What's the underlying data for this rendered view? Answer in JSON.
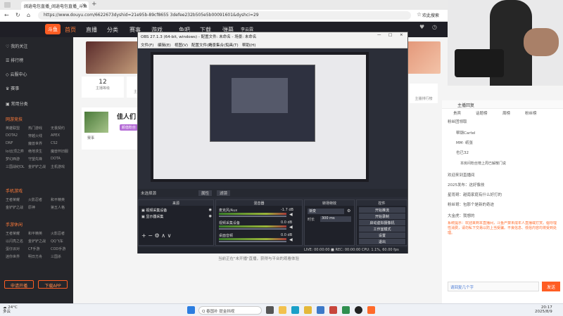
{
  "browser": {
    "tab_title": "阔逍电包直播_阔逍电包直播_斗鱼",
    "url": "https://www.douyu.com/6622673dyshid=21e95b-89cf8655 3defee232b505e5b00091601&dyshci=29",
    "profile_label": "欢此搜索"
  },
  "site": {
    "logo": "斗鱼",
    "nav": [
      "首页",
      "直播",
      "分类",
      "赛事",
      "游戏",
      "鱼吧",
      "下载",
      "弹幕",
      "李云霖"
    ],
    "sidebar": {
      "items": [
        "我的关注",
        "排行榜",
        "云服中心",
        "赛事",
        "常用分类"
      ],
      "section_hot": "网游竞技",
      "hot_grid": [
        "英雄联盟",
        "热门游戏",
        "无畏契约",
        "DOTA2",
        "穿越火线",
        "APEX",
        "DNF",
        "魔兽世界",
        "CS2",
        "lol云顶之弈",
        "绝地求生",
        "魔兽怀旧服",
        "梦幻西游",
        "守望先锋",
        "DOTA",
        "三国战纪OL",
        "金铲铲之战",
        "主机游戏"
      ],
      "section_mobile": "手机游戏",
      "mobile_grid": [
        "王者荣耀",
        "火影忍者",
        "和平精英",
        "金铲铲之战",
        "原神",
        "第五人格"
      ],
      "section_ent": "手游休闲",
      "ent_grid": [
        "王者荣耀",
        "和平精英",
        "火影忍者",
        "以闪亮之名",
        "金铲铲之战",
        "QQ飞车",
        "蛋仔派对",
        "CF手游",
        "COD手游",
        "迷你世界",
        "明日方舟",
        "三国杀"
      ],
      "btn_open": "申请开播",
      "btn_app": "下载APP"
    },
    "content": {
      "stat1_num": "12",
      "stat1_label": "主播等级",
      "stat2_label": "主播开门",
      "rec_title": "佳人们 Ⅱ",
      "rec_tag": "颜值粉丝",
      "rec_sub": "赛事",
      "stat3_label": "主播排行榜",
      "stat4_label": "主播V上线"
    },
    "right": {
      "tabs": [
        "主播回复",
        "贵宾",
        "话题榜",
        "周榜",
        "粉丝榜"
      ],
      "banner": "粉丝团领取",
      "rank1": "帮钢Cartel",
      "rank2": "MM· 纸张",
      "rank3": "也已32",
      "chat_header": "本房间粉丝榜上周已解散门说",
      "chat": [
        "欢迎来到直播间",
        "2025发布：这好像技",
        "星雨哥：越南家庭有什么好打的",
        "粉丝哥：包那个是新的奇迹",
        "大金虎：我想的"
      ],
      "notice": "系统提示：欢迎来到本直播间，斗鱼严禁未成年人直播或打赏。倡导理性消费，请勿私下交易以防上当受骗。不良信息、低俗内容均将受到处理。",
      "input_hint": "请回复几个字",
      "send": "发送"
    },
    "obs": {
      "title": "OBS 27.1.3 (64-bit, windows) - 配置文件: 未命名 - 场景: 未命名",
      "menu": [
        "文件(F)",
        "编辑(E)",
        "视图(V)",
        "配置文件(P)",
        "场景集合(S)",
        "工具(T)",
        "帮助(H)"
      ],
      "scene_label": "未选择源",
      "prop_btn": "属性",
      "filter_btn": "滤镜",
      "docks": {
        "scenes": "来源",
        "mixer": "混音器",
        "transitions": "转场特效",
        "controls": "控件"
      },
      "sources": [
        "视频采集设备",
        "显示器采集"
      ],
      "mixer": [
        {
          "name": "麦克风/Aux",
          "db": "-1.7 dB"
        },
        {
          "name": "视频采集设备",
          "db": "0.0 dB"
        },
        {
          "name": "桌面音频",
          "db": "0.0 dB"
        }
      ],
      "transition": {
        "type": "渐变",
        "duration_label": "时长",
        "duration": "300 ms"
      },
      "controls": [
        "开始推流",
        "开始录制",
        "启动虚拟摄像机",
        "工作室模式",
        "设置",
        "退出"
      ],
      "status": "LIVE: 00:00:00  ■ REC: 00:00:00  CPU: 1.1%, 60.00 fps",
      "footer": "当前正在\"未开播\"直播，获得与平台的观看体验"
    },
    "webcam_caption": ""
  },
  "taskbar": {
    "weather": "24°C",
    "weather_sub": "多云",
    "search": "Q 春国补 提金挡视",
    "time": "20:17",
    "date": "2025/8/9"
  },
  "colors": {
    "accent": "#ff5d23",
    "nav_bg": "#1f1f26",
    "sidebar_bg": "#25262b",
    "obs_bg": "#2b2e38"
  }
}
